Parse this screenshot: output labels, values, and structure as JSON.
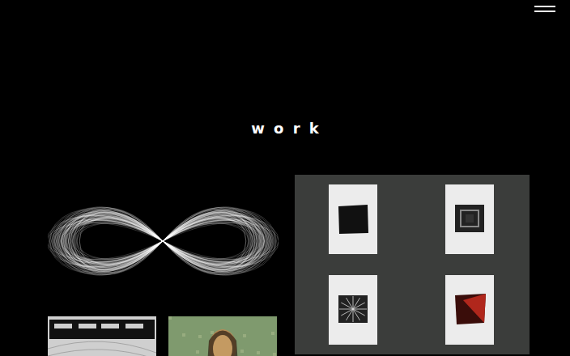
{
  "page": {
    "title": "work"
  },
  "gallery": [
    {
      "kind": "infinity"
    },
    {
      "kind": "squares"
    },
    {
      "kind": "type"
    },
    {
      "kind": "portrait"
    }
  ]
}
